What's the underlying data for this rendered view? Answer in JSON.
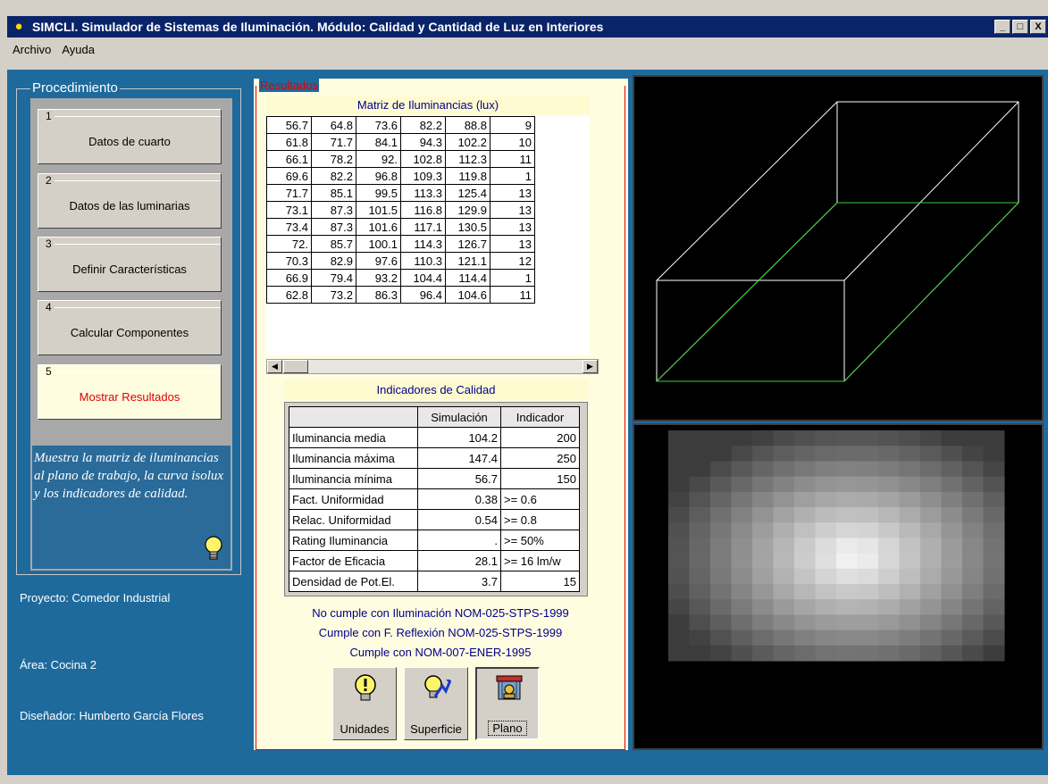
{
  "window": {
    "title": "SIMCLI. Simulador de Sistemas de Iluminación. Módulo: Calidad y Cantidad de Luz en Interiores",
    "minimize": "_",
    "maximize": "□",
    "close": "X"
  },
  "menu": {
    "items": [
      "Archivo",
      "Ayuda"
    ]
  },
  "procedimiento": {
    "title": "Procedimiento",
    "steps": [
      {
        "num": "1",
        "label": "Datos de cuarto"
      },
      {
        "num": "2",
        "label": "Datos de las luminarias"
      },
      {
        "num": "3",
        "label": "Definir Características"
      },
      {
        "num": "4",
        "label": "Calcular Componentes"
      },
      {
        "num": "5",
        "label": "Mostrar Resultados"
      }
    ],
    "description": "Muestra la matriz de iluminancias al plano de trabajo, la curva isolux y los indicadores de calidad."
  },
  "info": {
    "proyecto": "Proyecto: Comedor Industrial",
    "area": "Área: Cocina 2",
    "disenador": "Diseñador: Humberto García Flores"
  },
  "resultados": {
    "title": "Resultados",
    "matrix_title": "Matriz de Iluminancias (lux)",
    "matrix": [
      [
        "56.7",
        "64.8",
        "73.6",
        "82.2",
        "88.8",
        "9"
      ],
      [
        "61.8",
        "71.7",
        "84.1",
        "94.3",
        "102.2",
        "10"
      ],
      [
        "66.1",
        "78.2",
        "92.",
        "102.8",
        "112.3",
        "11"
      ],
      [
        "69.6",
        "82.2",
        "96.8",
        "109.3",
        "119.8",
        "1"
      ],
      [
        "71.7",
        "85.1",
        "99.5",
        "113.3",
        "125.4",
        "13"
      ],
      [
        "73.1",
        "87.3",
        "101.5",
        "116.8",
        "129.9",
        "13"
      ],
      [
        "73.4",
        "87.3",
        "101.6",
        "117.1",
        "130.5",
        "13"
      ],
      [
        "72.",
        "85.7",
        "100.1",
        "114.3",
        "126.7",
        "13"
      ],
      [
        "70.3",
        "82.9",
        "97.6",
        "110.3",
        "121.1",
        "12"
      ],
      [
        "66.9",
        "79.4",
        "93.2",
        "104.4",
        "114.4",
        "1"
      ],
      [
        "62.8",
        "73.2",
        "86.3",
        "96.4",
        "104.6",
        "11"
      ]
    ],
    "quality_title": "Indicadores de Calidad",
    "quality_headers": [
      "",
      "Simulación",
      "Indicador"
    ],
    "quality_rows": [
      {
        "label": "Iluminancia media",
        "sim": "104.2",
        "ind": "200",
        "ind_num": true
      },
      {
        "label": "Iluminancia máxima",
        "sim": "147.4",
        "ind": "250",
        "ind_num": true
      },
      {
        "label": "Iluminancia mínima",
        "sim": "56.7",
        "ind": "150",
        "ind_num": true
      },
      {
        "label": "Fact. Uniformidad",
        "sim": "0.38",
        "ind": ">= 0.6",
        "ind_num": false
      },
      {
        "label": "Relac. Uniformidad",
        "sim": "0.54",
        "ind": ">= 0.8",
        "ind_num": false
      },
      {
        "label": "Rating Iluminancia",
        "sim": ".",
        "ind": ">= 50%",
        "ind_num": false
      },
      {
        "label": "Factor de Eficacia",
        "sim": "28.1",
        "ind": ">= 16 lm/w",
        "ind_num": false
      },
      {
        "label": "Densidad de Pot.El.",
        "sim": "3.7",
        "ind": "15",
        "ind_num": true
      }
    ],
    "status": [
      "No cumple con Iluminación NOM-025-STPS-1999",
      "Cumple con F. Reflexión NOM-025-STPS-1999",
      "Cumple con NOM-007-ENER-1995"
    ],
    "buttons": [
      {
        "label": "Unidades",
        "icon": "bulb-warning-icon"
      },
      {
        "label": "Superficie",
        "icon": "bulb-arrow-icon"
      },
      {
        "label": "Plano",
        "icon": "plane-lamp-icon"
      }
    ]
  },
  "colors": {
    "client_bg": "#1e6a9c",
    "panel_bg": "#fffde0",
    "titlebar": "#0a246a",
    "active_step_text": "#e00000"
  }
}
